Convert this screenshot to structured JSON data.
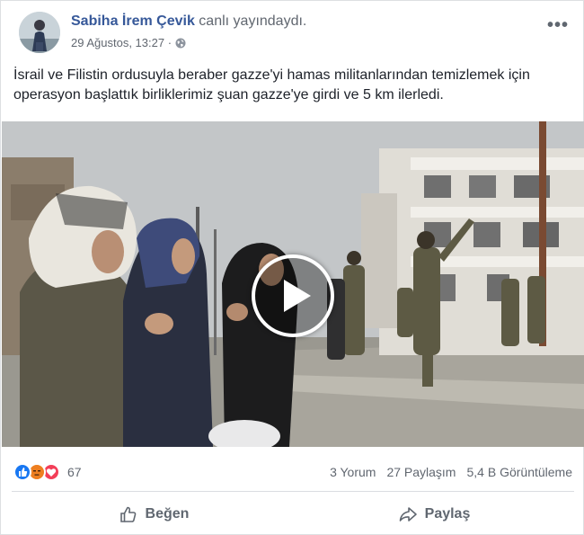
{
  "header": {
    "author_name": "Sabiha İrem Çevik",
    "action_text": "canlı yayındaydı.",
    "timestamp": "29 Ağustos, 13:27 · ",
    "privacy_icon": "globe-icon",
    "more_icon": "more-options-icon"
  },
  "post": {
    "text": "İsrail ve Filistin ordusuyla beraber gazze'yi hamas militanlarından temizlemek için operasyon başlattık birliklerimiz şuan gazze'ye girdi ve 5 km ilerledi."
  },
  "video": {
    "play_icon": "play-icon"
  },
  "stats": {
    "reaction_icons": [
      "like-reaction-icon",
      "angry-reaction-icon",
      "love-reaction-icon"
    ],
    "reaction_count": "67",
    "comments": "3 Yorum",
    "shares": "27 Paylaşım",
    "views": "5,4 B Görüntüleme"
  },
  "actions": {
    "like_label": "Beğen",
    "share_label": "Paylaş"
  },
  "colors": {
    "link": "#365899",
    "secondary_text": "#616770",
    "like_blue": "#1877f2",
    "angry_yellow": "#f7b125",
    "love_red": "#f33e58"
  }
}
